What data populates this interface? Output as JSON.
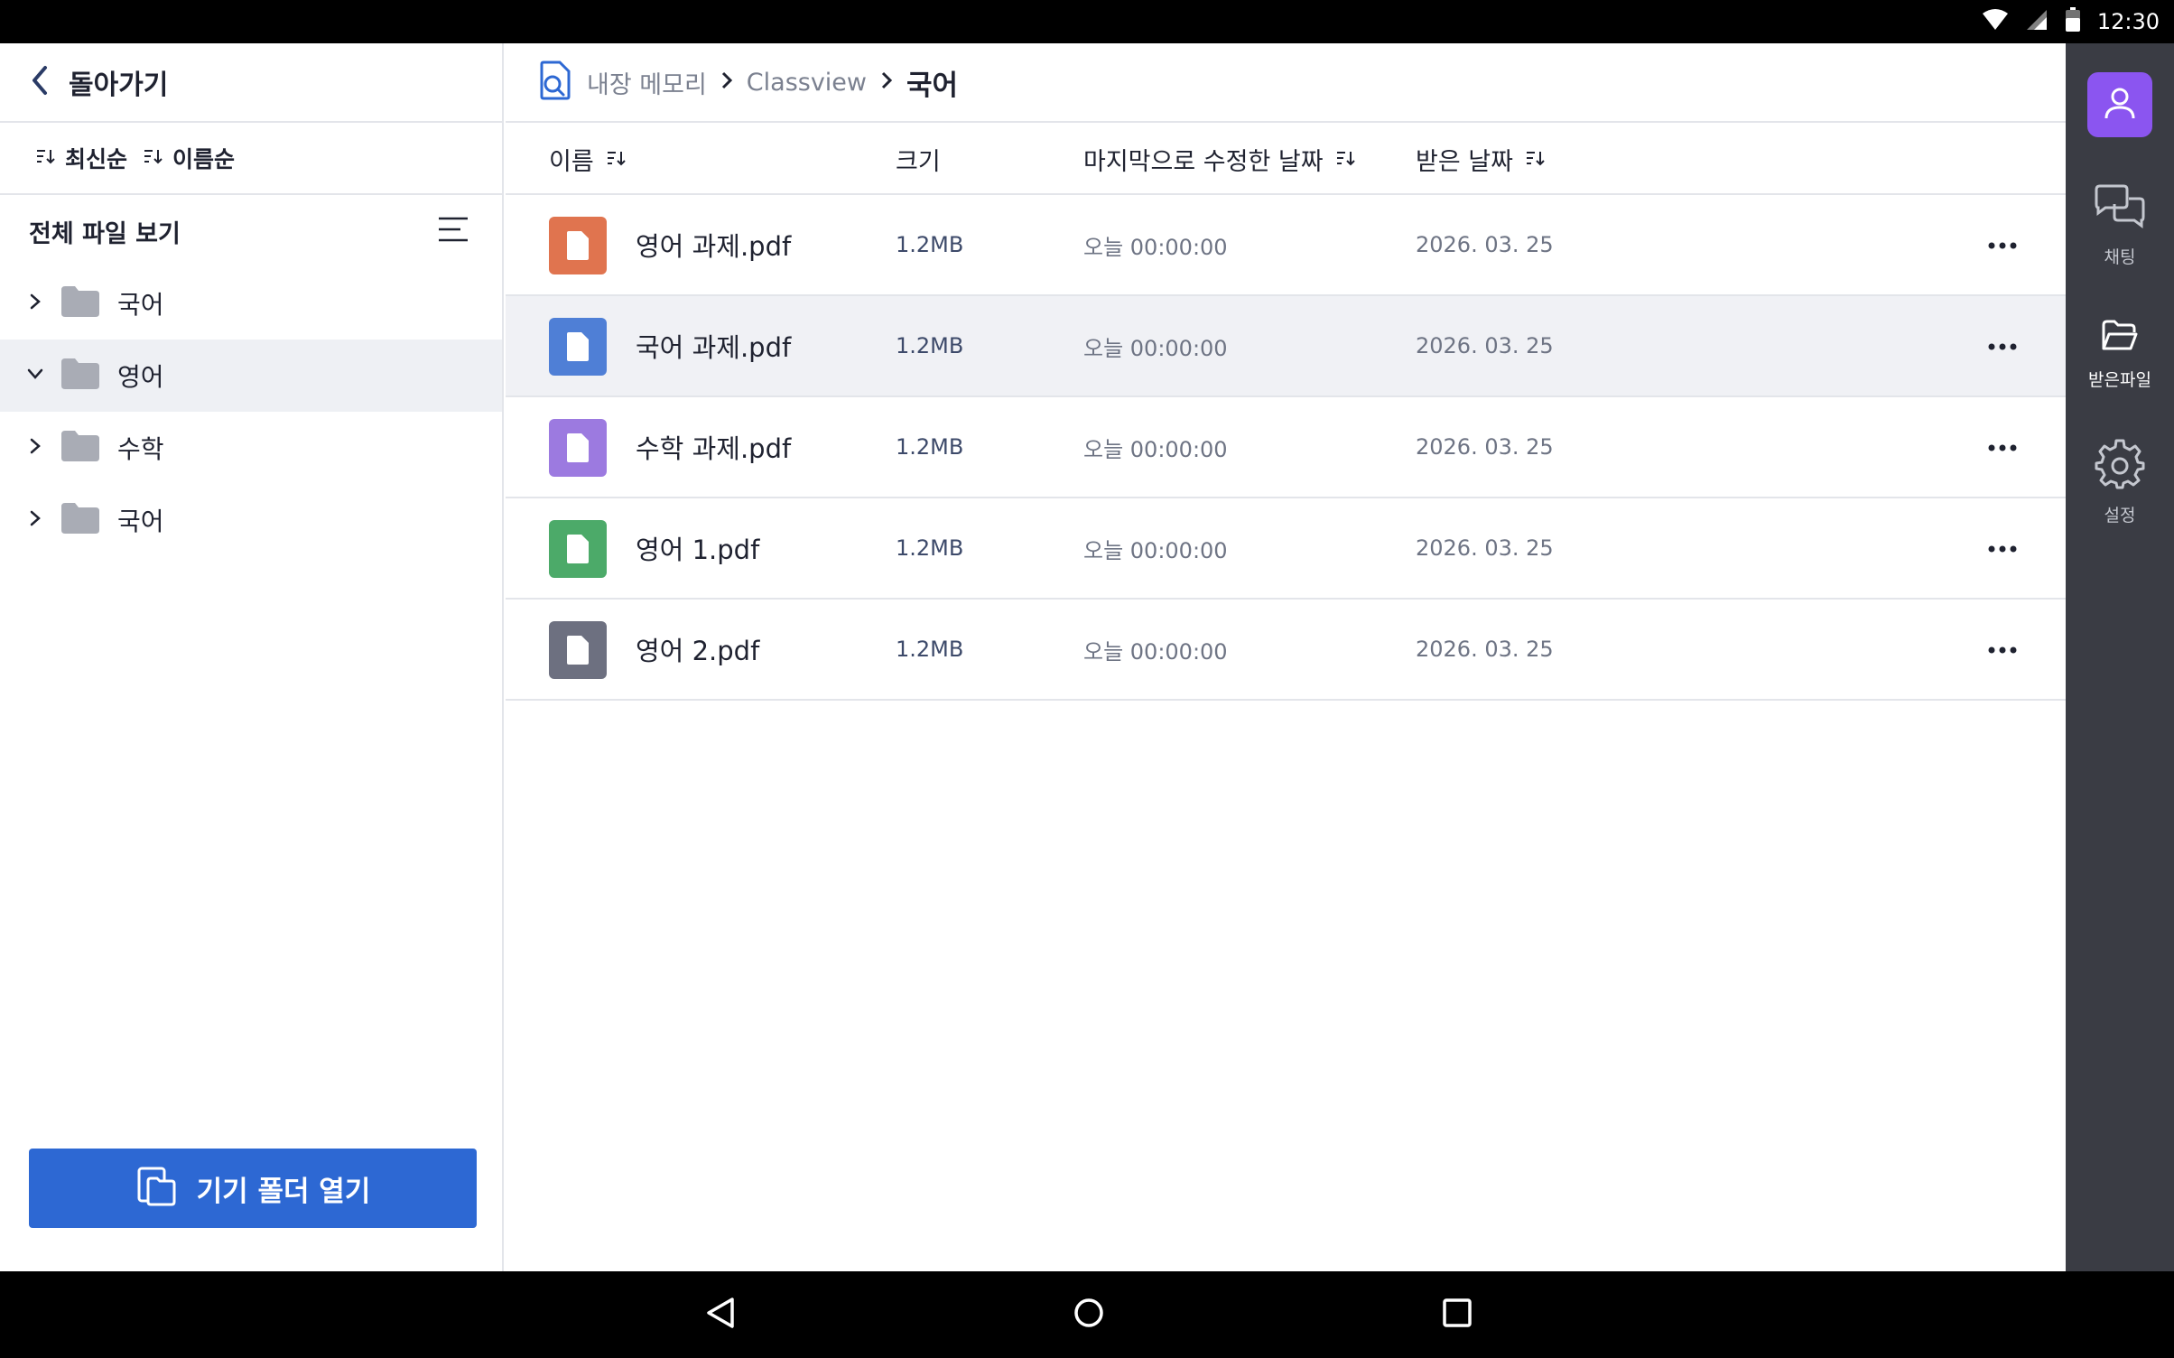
{
  "status_bar": {
    "time": "12:30",
    "icons": [
      "wifi-icon",
      "signal-icon",
      "battery-icon"
    ]
  },
  "sidebar": {
    "back_label": "돌아가기",
    "sort_options": [
      {
        "label": "최신순",
        "icon": "sort-icon"
      },
      {
        "label": "이름순",
        "icon": "sort-icon"
      }
    ],
    "all_files_label": "전체 파일 보기",
    "folders": [
      {
        "label": "국어",
        "expanded": false,
        "selected": false
      },
      {
        "label": "영어",
        "expanded": true,
        "selected": true
      },
      {
        "label": "수학",
        "expanded": false,
        "selected": false
      },
      {
        "label": "국어",
        "expanded": false,
        "selected": false
      }
    ],
    "open_folder_button": "기기 폴더 열기"
  },
  "breadcrumb": {
    "items": [
      "내장 메모리",
      "Classview",
      "국어"
    ]
  },
  "table": {
    "headers": {
      "name": "이름",
      "size": "크기",
      "modified": "마지막으로 수정한 날짜",
      "received": "받은 날짜"
    },
    "rows": [
      {
        "name": "영어 과제.pdf",
        "size": "1.2MB",
        "modified": "오늘 00:00:00",
        "received": "2026. 03. 25",
        "icon_color": "#e0744f",
        "highlight": false
      },
      {
        "name": "국어 과제.pdf",
        "size": "1.2MB",
        "modified": "오늘 00:00:00",
        "received": "2026. 03. 25",
        "icon_color": "#4f7fd6",
        "highlight": true
      },
      {
        "name": "수학 과제.pdf",
        "size": "1.2MB",
        "modified": "오늘 00:00:00",
        "received": "2026. 03. 25",
        "icon_color": "#9c7ae0",
        "highlight": false
      },
      {
        "name": "영어 1.pdf",
        "size": "1.2MB",
        "modified": "오늘 00:00:00",
        "received": "2026. 03. 25",
        "icon_color": "#4caa69",
        "highlight": false
      },
      {
        "name": "영어 2.pdf",
        "size": "1.2MB",
        "modified": "오늘 00:00:00",
        "received": "2026. 03. 25",
        "icon_color": "#6d7080",
        "highlight": false
      }
    ]
  },
  "rail": {
    "profile_color": "#8b55f0",
    "items": [
      {
        "label": "채팅",
        "icon": "chat-icon",
        "active": false
      },
      {
        "label": "받은파일",
        "icon": "folder-open-icon",
        "active": true
      },
      {
        "label": "설정",
        "icon": "gear-icon",
        "active": false
      }
    ]
  },
  "colors": {
    "accent": "#2d68d3",
    "rail_bg": "#3a3c44",
    "selected_bg": "#eef0f4"
  }
}
